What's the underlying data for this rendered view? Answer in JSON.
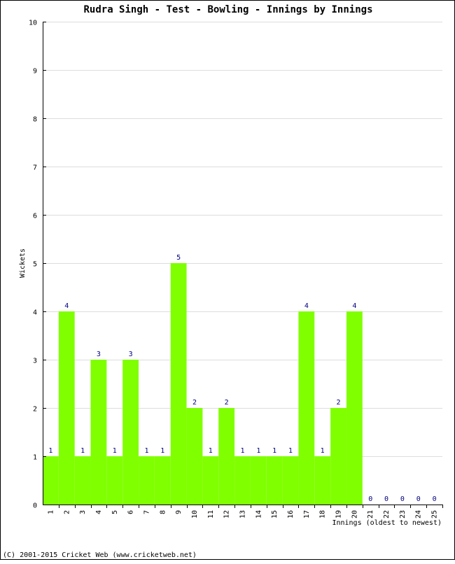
{
  "chart_data": {
    "type": "bar",
    "title": "Rudra Singh - Test - Bowling - Innings by Innings",
    "xlabel": "Innings (oldest to newest)",
    "ylabel": "Wickets",
    "ylim": [
      0,
      10
    ],
    "yticks": [
      0,
      1,
      2,
      3,
      4,
      5,
      6,
      7,
      8,
      9,
      10
    ],
    "grid": true,
    "bar_color": "#80ff00",
    "label_color": "#000080",
    "categories": [
      "1",
      "2",
      "3",
      "4",
      "5",
      "6",
      "7",
      "8",
      "9",
      "10",
      "11",
      "12",
      "13",
      "14",
      "15",
      "16",
      "17",
      "18",
      "19",
      "20",
      "21",
      "22",
      "23",
      "24",
      "25"
    ],
    "values": [
      1,
      4,
      1,
      3,
      1,
      3,
      1,
      1,
      5,
      2,
      1,
      2,
      1,
      1,
      1,
      1,
      4,
      1,
      2,
      4,
      0,
      0,
      0,
      0,
      0
    ]
  },
  "footer": {
    "copyright": "(C) 2001-2015 Cricket Web (www.cricketweb.net)"
  }
}
